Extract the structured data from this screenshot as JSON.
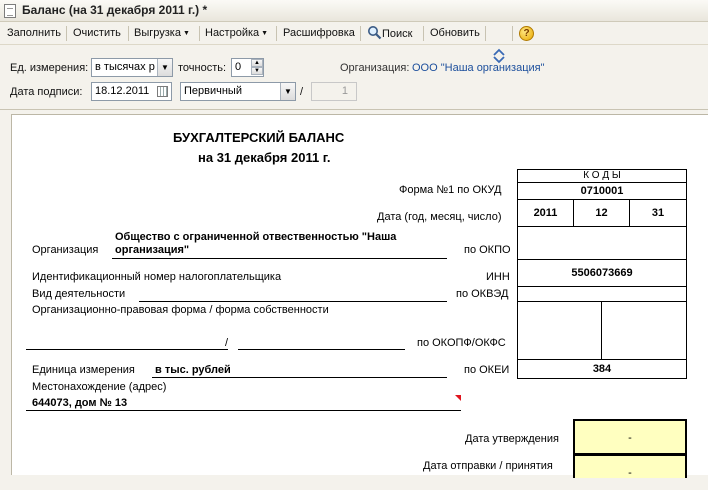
{
  "window": {
    "title": "Баланс (на 31 декабря 2011 г.) *"
  },
  "toolbar": {
    "fill": "Заполнить",
    "clear": "Очистить",
    "export": "Выгрузка",
    "settings": "Настройка",
    "decode": "Расшифровка",
    "search": "Поиск",
    "refresh": "Обновить",
    "help_icon": "?"
  },
  "params": {
    "unit_label": "Ед. измерения:",
    "unit_value": "в тысячах р",
    "precision_label": "точность:",
    "precision_value": "0",
    "org_label": "Организация:",
    "org_value": "ООО \"Наша организация\"",
    "sign_date_label": "Дата подписи:",
    "sign_date_value": "18.12.2011",
    "doc_type_value": "Первичный",
    "slash": "/",
    "correction_value": "1"
  },
  "report": {
    "title": "БУХГАЛТЕРСКИЙ БАЛАНС",
    "subtitle": "на 31 декабря 2011 г.",
    "codes_header": "К О Д Ы",
    "form_label": "Форма №1 по ОКУД",
    "form_code": "0710001",
    "date_label": "Дата (год, месяц, число)",
    "date_year": "2011",
    "date_month": "12",
    "date_day": "31",
    "org_label": "Организация",
    "org_name": "Общество с ограниченной отвественностью \"Наша организация\"",
    "okpo_label": "по ОКПО",
    "inn_label_left": "Идентификационный номер налогоплательщика",
    "inn_label": "ИНН",
    "inn_value": "5506073669",
    "activity_label": "Вид деятельности",
    "okved_label": "по ОКВЭД",
    "legal_form_label": "Организационно-правовая форма / форма собственности",
    "legal_slash": "/",
    "okopf_label": "по ОКОПФ/ОКФС",
    "unit_label": "Единица измерения",
    "unit_value": "в тыс. рублей",
    "okei_label": "по ОКЕИ",
    "okei_value": "384",
    "address_label": "Местонахождение (адрес)",
    "address_value": "644073, дом № 13",
    "approval_label": "Дата утверждения",
    "approval_value": "-",
    "send_label": "Дата отправки / принятия",
    "send_value": "-"
  }
}
